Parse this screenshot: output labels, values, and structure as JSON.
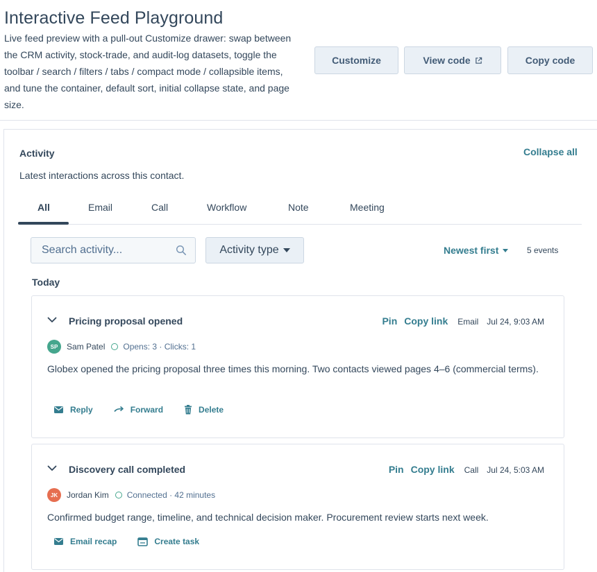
{
  "header": {
    "title": "Interactive Feed Playground",
    "description": "Live feed preview with a pull-out Customize drawer: swap between the CRM activity, stock-trade, and audit-log datasets, toggle the toolbar / search / filters / tabs / compact mode / collapsible items, and tune the container, default sort, initial collapse state, and page size.",
    "buttons": {
      "customize": "Customize",
      "view_code": "View code",
      "copy_code": "Copy code"
    }
  },
  "feed": {
    "title": "Activity",
    "subtitle": "Latest interactions across this contact.",
    "collapse_all": "Collapse all",
    "tabs": [
      "All",
      "Email",
      "Call",
      "Workflow",
      "Note",
      "Meeting"
    ],
    "active_tab": "All",
    "search_placeholder": "Search activity...",
    "filter_label": "Activity type",
    "sort_label": "Newest first",
    "events_count": "5 events",
    "group_label": "Today",
    "items": [
      {
        "title": "Pricing proposal opened",
        "pin": "Pin",
        "copy_link": "Copy link",
        "type": "Email",
        "time": "Jul 24, 9:03 AM",
        "avatar_initials": "SP",
        "avatar_color": "#45a68d",
        "author": "Sam Patel",
        "stats": "Opens: 3 · Clicks: 1",
        "body": "Globex opened the pricing proposal three times this morning. Two contacts viewed pages 4–6 (commercial terms).",
        "actions": [
          {
            "icon": "mail-icon",
            "label": "Reply"
          },
          {
            "icon": "forward-arrow-icon",
            "label": "Forward"
          },
          {
            "icon": "trash-icon",
            "label": "Delete"
          }
        ]
      },
      {
        "title": "Discovery call completed",
        "pin": "Pin",
        "copy_link": "Copy link",
        "type": "Call",
        "time": "Jul 24, 5:03 AM",
        "avatar_initials": "JK",
        "avatar_color": "#e66e50",
        "author": "Jordan Kim",
        "stats": "Connected · 42 minutes",
        "body": "Confirmed budget range, timeline, and technical decision maker. Procurement review starts next week.",
        "actions": [
          {
            "icon": "mail-icon",
            "label": "Email recap"
          },
          {
            "icon": "task-icon",
            "label": "Create task"
          }
        ]
      }
    ]
  },
  "colors": {
    "accent": "#347d8f",
    "text": "#33475b",
    "button_bg": "#eaf0f6",
    "border": "#dfe3eb"
  }
}
